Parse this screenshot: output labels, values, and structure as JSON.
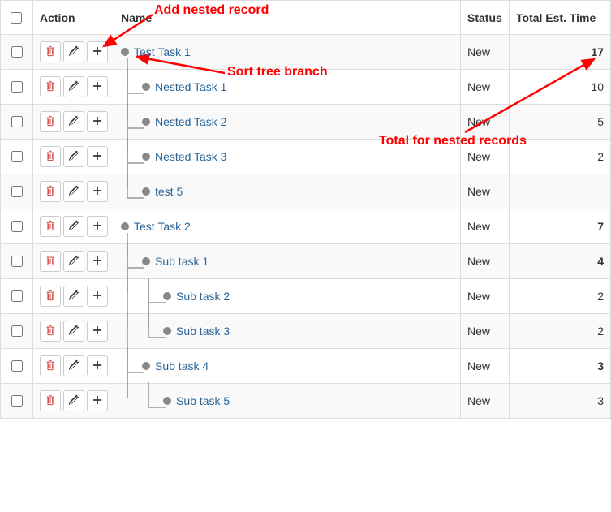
{
  "columns": {
    "action": "Action",
    "name": "Name",
    "status": "Status",
    "time": "Total Est. Time"
  },
  "rows": [
    {
      "label": "Test Task 1",
      "status": "New",
      "time": "17",
      "indent": 0,
      "bold": true,
      "vlines": [],
      "elbow": false
    },
    {
      "label": "Nested Task 1",
      "status": "New",
      "time": "10",
      "indent": 1,
      "bold": false,
      "vlines": [
        0
      ],
      "elbow": true
    },
    {
      "label": "Nested Task 2",
      "status": "New",
      "time": "5",
      "indent": 1,
      "bold": false,
      "vlines": [
        0
      ],
      "elbow": true
    },
    {
      "label": "Nested Task 3",
      "status": "New",
      "time": "2",
      "indent": 1,
      "bold": false,
      "vlines": [
        0
      ],
      "elbow": true
    },
    {
      "label": "test 5",
      "status": "New",
      "time": "",
      "indent": 1,
      "bold": false,
      "vlines": [],
      "elbow": true,
      "lastChild": true
    },
    {
      "label": "Test Task 2",
      "status": "New",
      "time": "7",
      "indent": 0,
      "bold": true,
      "vlines": [],
      "elbow": false
    },
    {
      "label": "Sub task 1",
      "status": "New",
      "time": "4",
      "indent": 1,
      "bold": true,
      "vlines": [
        0
      ],
      "elbow": true
    },
    {
      "label": "Sub task 2",
      "status": "New",
      "time": "2",
      "indent": 2,
      "bold": false,
      "vlines": [
        0,
        1
      ],
      "elbow": true
    },
    {
      "label": "Sub task 3",
      "status": "New",
      "time": "2",
      "indent": 2,
      "bold": false,
      "vlines": [
        0
      ],
      "elbow": true,
      "lastChild": true
    },
    {
      "label": "Sub task 4",
      "status": "New",
      "time": "3",
      "indent": 1,
      "bold": true,
      "vlines": [
        0
      ],
      "elbow": true
    },
    {
      "label": "Sub task 5",
      "status": "New",
      "time": "3",
      "indent": 2,
      "bold": false,
      "vlines": [],
      "elbow": true,
      "lastChild": true,
      "lastTop": true
    }
  ],
  "annotations": {
    "addNested": "Add nested record",
    "sortTree": "Sort tree branch",
    "totalNested": "Total for nested records"
  },
  "colors": {
    "annotation": "#ff0000",
    "link": "#2a6496"
  }
}
